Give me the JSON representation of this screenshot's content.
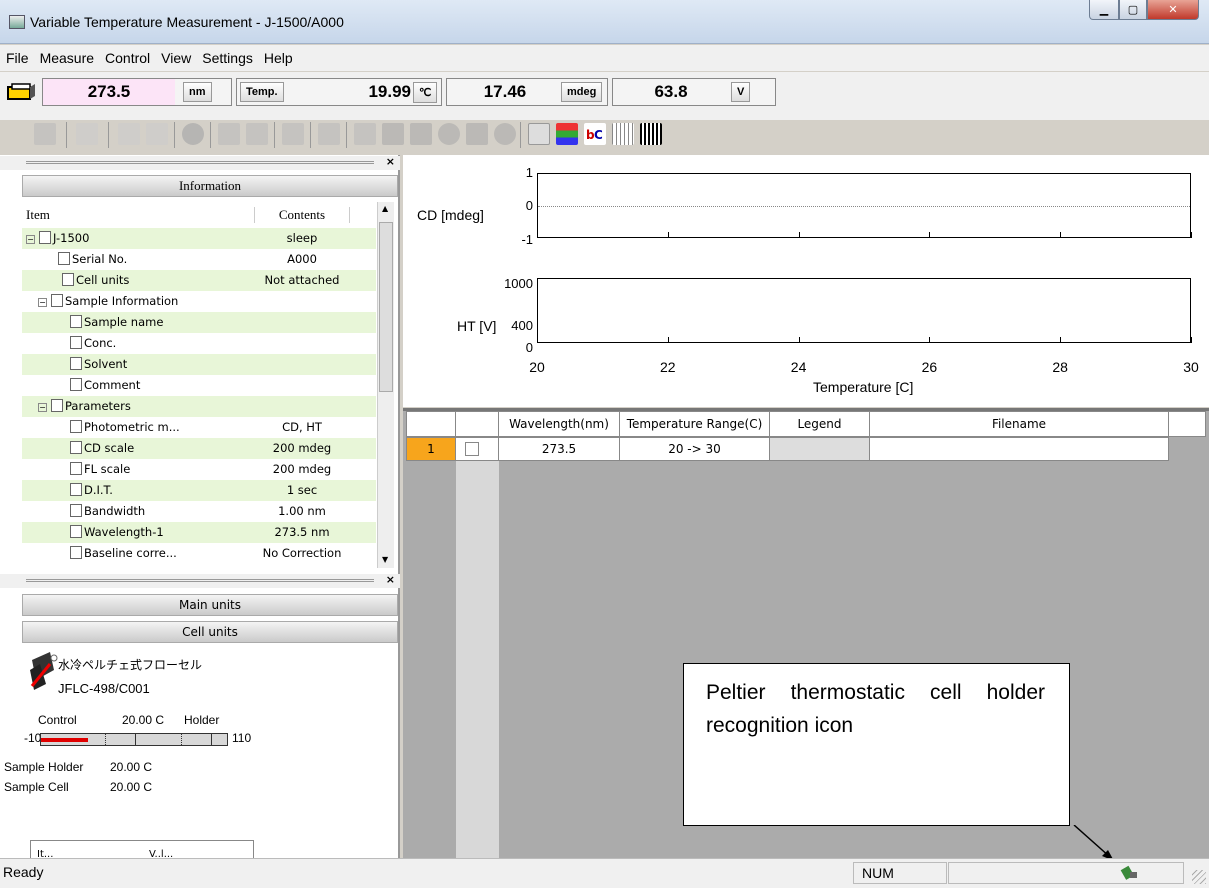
{
  "window": {
    "title": "Variable Temperature Measurement - J-1500/A000",
    "controls": [
      "minimize",
      "maximize",
      "close"
    ]
  },
  "menu": {
    "items": [
      "File",
      "Measure",
      "Control",
      "View",
      "Settings",
      "Help"
    ]
  },
  "readouts": {
    "wavelength": "273.5",
    "wavelength_unit": "nm",
    "temp_label": "Temp.",
    "temp": "19.99",
    "temp_unit": "℃",
    "cd": "17.46",
    "cd_unit": "mdeg",
    "ht": "63.8",
    "ht_unit": "V"
  },
  "info_panel": {
    "title": "Information",
    "columns": [
      "Item",
      "Contents"
    ],
    "rows": [
      {
        "item": "J-1500",
        "contents": "sleep",
        "toggle": "⊟"
      },
      {
        "item": "Serial No.",
        "contents": "A000"
      },
      {
        "item": "Cell units",
        "contents": "Not attached"
      },
      {
        "item": "Sample Information",
        "contents": "",
        "toggle": "⊟"
      },
      {
        "item": "Sample name",
        "contents": ""
      },
      {
        "item": "Conc.",
        "contents": ""
      },
      {
        "item": "Solvent",
        "contents": ""
      },
      {
        "item": "Comment",
        "contents": ""
      },
      {
        "item": "Parameters",
        "contents": "",
        "toggle": "⊟"
      },
      {
        "item": "Photometric m...",
        "contents": "CD, HT"
      },
      {
        "item": "CD scale",
        "contents": "200 mdeg"
      },
      {
        "item": "FL scale",
        "contents": "200 mdeg"
      },
      {
        "item": "D.I.T.",
        "contents": "1 sec"
      },
      {
        "item": "Bandwidth",
        "contents": "1.00 nm"
      },
      {
        "item": "Wavelength-1",
        "contents": "273.5 nm"
      },
      {
        "item": "Baseline corre...",
        "contents": "No Correction"
      }
    ]
  },
  "units_panel": {
    "main_units": "Main units",
    "cell_units": "Cell units",
    "device_name": "水冷ペルチェ式フローセル",
    "device_model": "JFLC-498/C001",
    "control_label": "Control",
    "control_value": "20.00 C",
    "holder_label": "Holder",
    "scale_min": "-10",
    "scale_max": "110",
    "sample_holder_label": "Sample Holder",
    "sample_holder_value": "20.00 C",
    "sample_cell_label": "Sample Cell",
    "sample_cell_value": "20.00 C",
    "mini_table_cols": [
      "It...",
      "V..l..."
    ]
  },
  "graph": {
    "cd_ylabel": "CD [mdeg]",
    "cd_ticks": [
      "1",
      "0",
      "-1"
    ],
    "ht_ylabel": "HT [V]",
    "ht_ticks": [
      "1000",
      "400",
      "0"
    ],
    "x_ticks": [
      "20",
      "22",
      "24",
      "26",
      "28",
      "30"
    ],
    "xlabel": "Temperature [C]"
  },
  "measure_table": {
    "columns": [
      "Wavelength(nm)",
      "Temperature Range(C)",
      "Legend",
      "Filename"
    ],
    "rows": [
      {
        "index": "1",
        "wavelength": "273.5",
        "range": "20 -> 30",
        "legend": "",
        "filename": ""
      }
    ]
  },
  "callout": {
    "text": "Peltier thermostatic cell holder recognition icon"
  },
  "statusbar": {
    "ready": "Ready",
    "num": "NUM"
  },
  "colors": {
    "highlight_row": "#e8f6d8",
    "temp_box": "#fce4f7",
    "index_cell": "#f7a51c",
    "red_bar": "#e00000"
  }
}
